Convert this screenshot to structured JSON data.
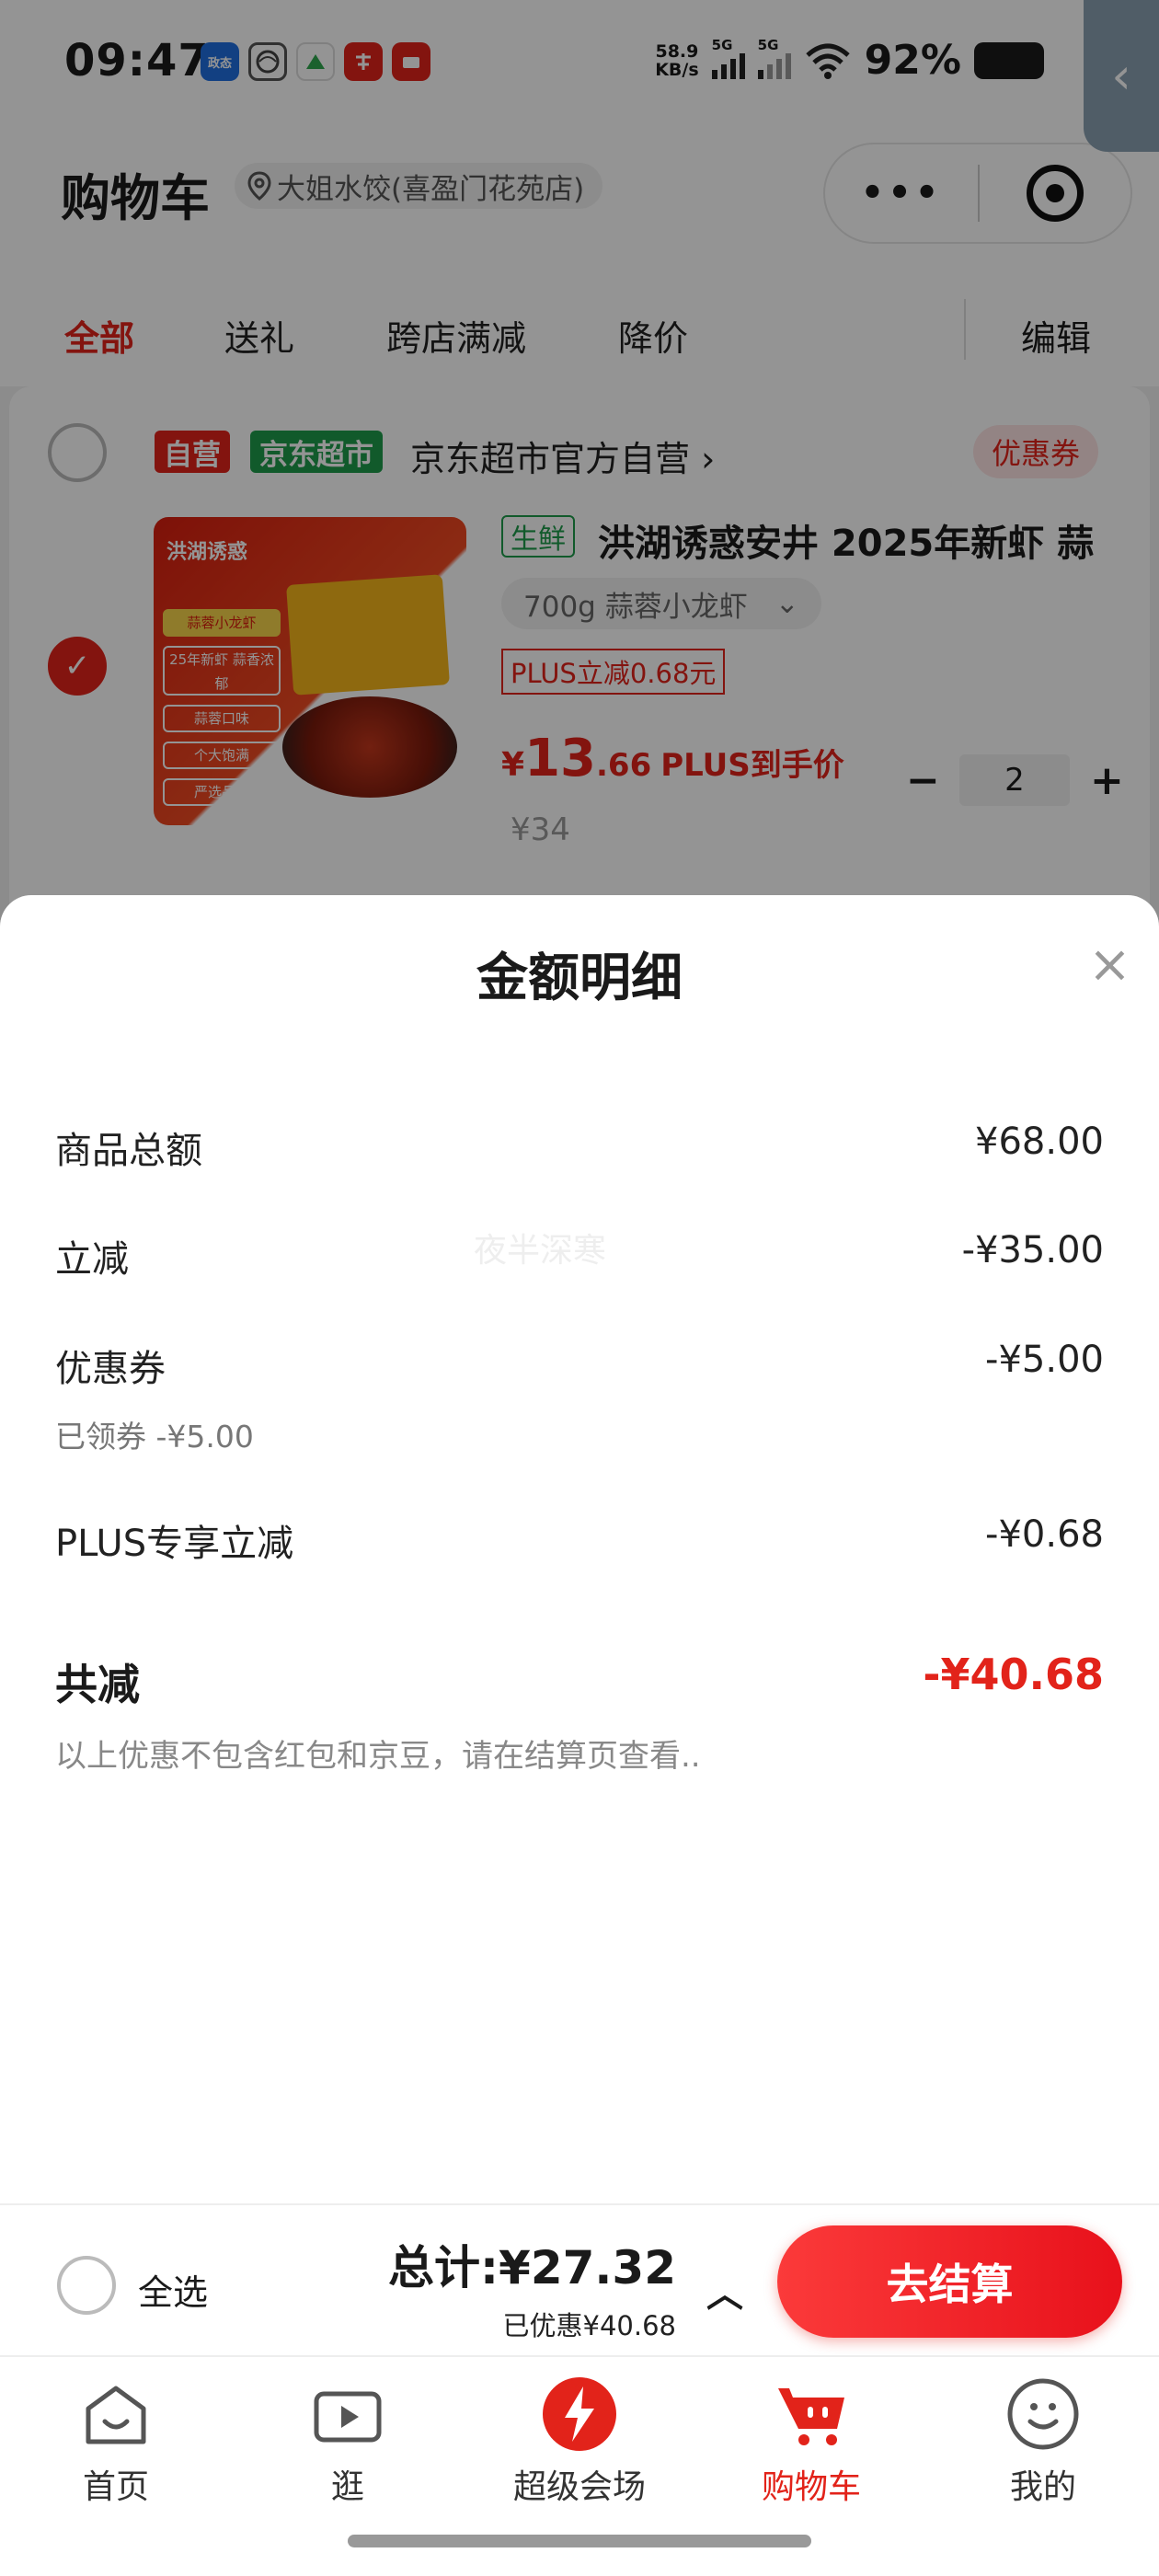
{
  "status_bar": {
    "time": "09:47",
    "apps": [
      {
        "name": "政态",
        "icon": "app-blue-icon",
        "color": "#1f6fe0"
      },
      {
        "name": "",
        "icon": "mobile-operator-icon",
        "color": "#666666"
      },
      {
        "name": "",
        "icon": "ai-app-icon",
        "color": "#2fa84f"
      },
      {
        "name": "",
        "icon": "study-app-icon",
        "color": "#e2231a"
      },
      {
        "name": "",
        "icon": "pay-app-icon",
        "color": "#e2231a"
      }
    ],
    "net_speed_value": "58.9",
    "net_speed_unit": "KB/s",
    "signal1_tag": "5G",
    "signal2_tag": "5G",
    "battery": "92%"
  },
  "side_tab": {
    "icon": "chevron-left-icon"
  },
  "header": {
    "title": "购物车",
    "address": "大姐水饺(喜盈门花苑店)",
    "capsule_more": "•••",
    "capsule_close_icon": "target-icon"
  },
  "tabs": [
    {
      "label": "全部",
      "active": true
    },
    {
      "label": "送礼",
      "active": false
    },
    {
      "label": "跨店满减",
      "active": false
    },
    {
      "label": "降价",
      "active": false
    }
  ],
  "edit_label": "编辑",
  "store": {
    "badge_self": "自营",
    "badge_market": "京东超市",
    "name": "京东超市官方自营",
    "name_arrow": "›",
    "coupon": "优惠券",
    "product": {
      "image_brand": "洪湖诱惑",
      "image_tags": [
        "蒜蓉小龙虾",
        "25年新虾 蒜香浓郁",
        "蒜蓉口味",
        "个大饱满",
        "严选品质"
      ],
      "fresh_tag": "生鲜",
      "title": "洪湖诱惑安井 2025年新虾 蒜",
      "spec": "700g 蒜蓉小龙虾",
      "spec_caret": "⌄",
      "plus_discount": "PLUS立减0.68元",
      "price_yen": "¥",
      "price_int": "13",
      "price_dec": ".66",
      "price_note": "PLUS到手价",
      "orig_price": "¥34",
      "qty": "2",
      "minus": "−",
      "plus": "+"
    }
  },
  "sheet": {
    "title": "金额明细",
    "close": "×",
    "watermark": "夜半深寒",
    "rows": [
      {
        "label": "商品总额",
        "value": "¥68.00"
      },
      {
        "label": "立减",
        "value": "-¥35.00"
      },
      {
        "label": "优惠券",
        "value": "-¥5.00",
        "sub": "已领券 -¥5.00"
      },
      {
        "label": "PLUS专享立减",
        "value": "-¥0.68"
      }
    ],
    "total_label": "共减",
    "total_value": "-¥40.68",
    "total_note": "以上优惠不包含红包和京豆，请在结算页查看.."
  },
  "checkout": {
    "select_all": "全选",
    "total": "总计:¥27.32",
    "saved": "已优惠¥40.68",
    "caret": "︿",
    "button": "去结算"
  },
  "nav": [
    {
      "label": "首页",
      "icon": "home-icon",
      "active": false
    },
    {
      "label": "逛",
      "icon": "video-play-icon",
      "active": false
    },
    {
      "label": "超级会场",
      "icon": "super-venue-icon",
      "active": false
    },
    {
      "label": "购物车",
      "icon": "cart-icon",
      "active": true
    },
    {
      "label": "我的",
      "icon": "profile-face-icon",
      "active": false
    }
  ],
  "colors": {
    "brand_red": "#e2231a",
    "fresh_green": "#1e9b4a",
    "market_green": "#1e9b4a"
  }
}
